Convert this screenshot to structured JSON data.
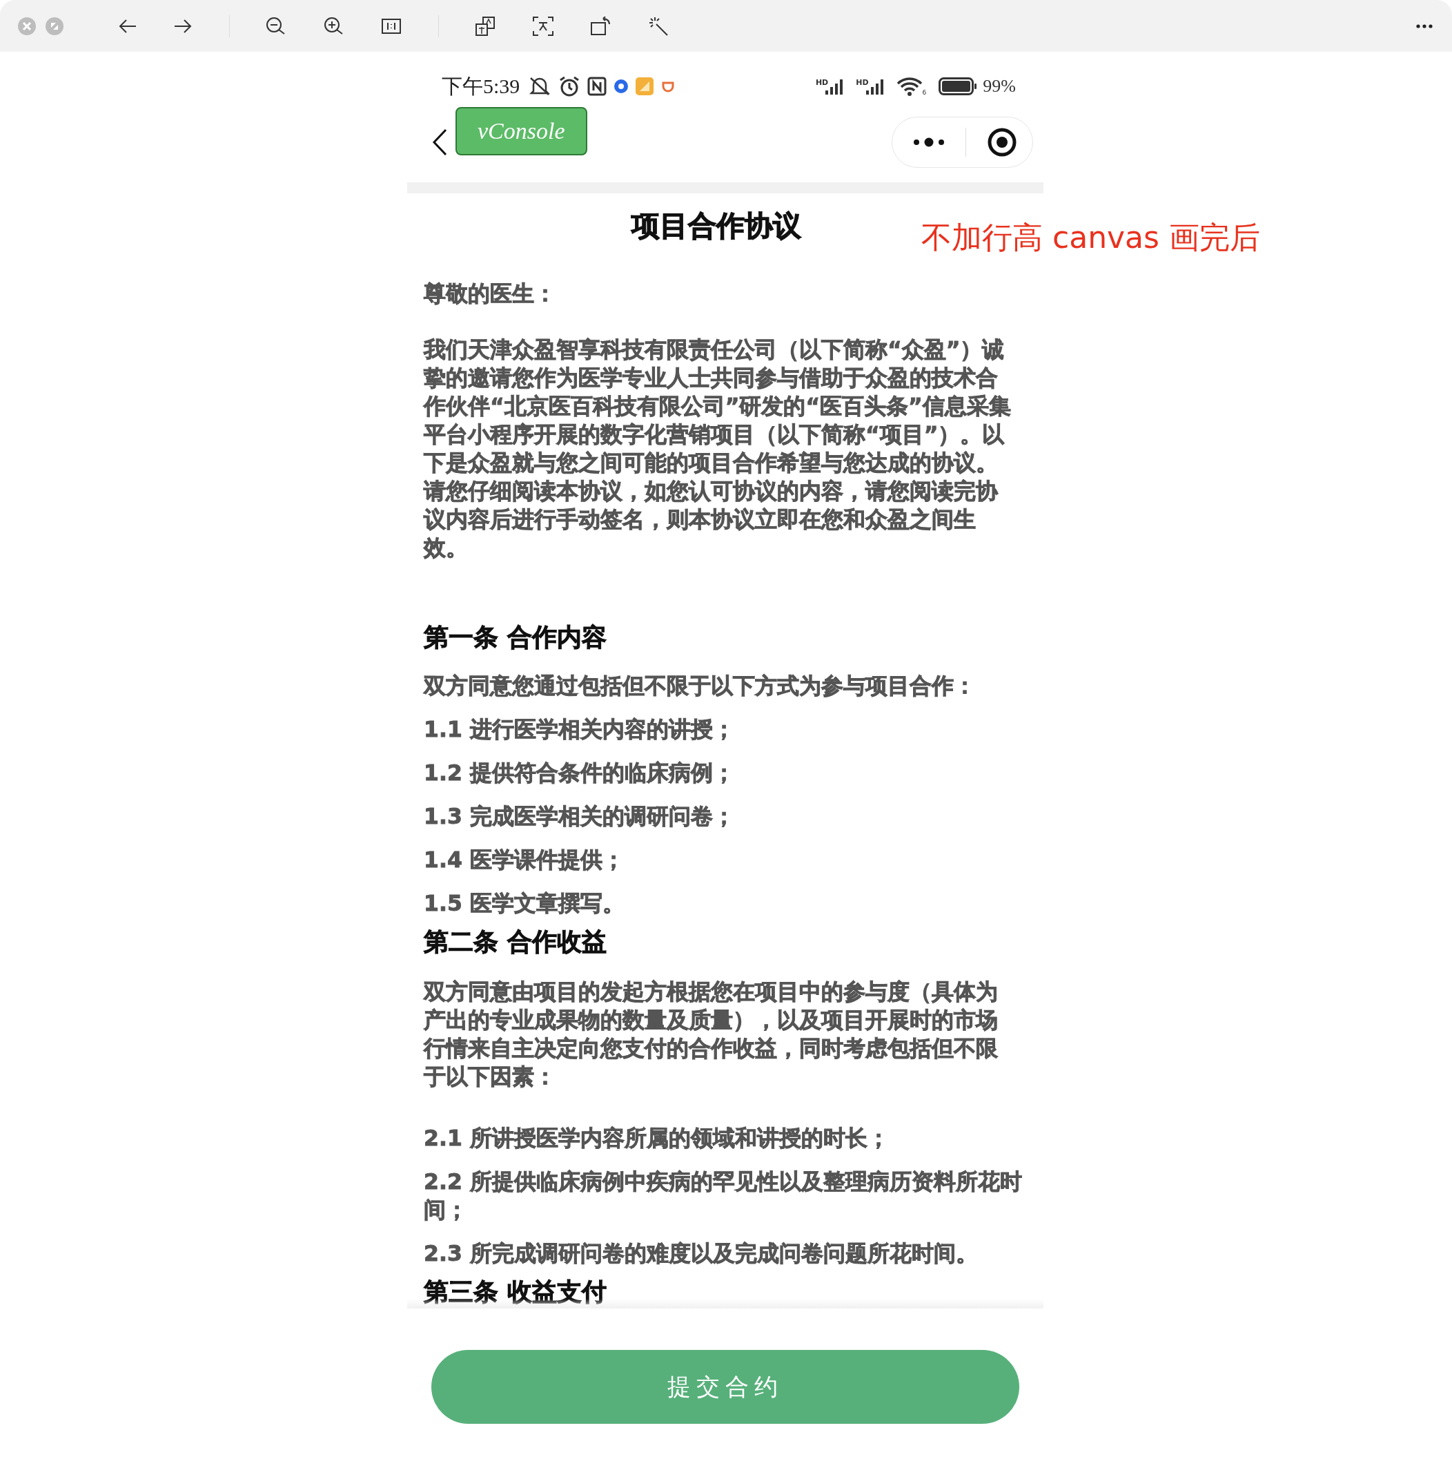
{
  "status_bar": {
    "time": "下午5:39",
    "signal_labels": [
      "HD",
      "HD"
    ],
    "wifi_band": "6",
    "battery": "99%"
  },
  "nav_bar": {
    "vconsole": "vConsole"
  },
  "annotation": "不加行高 canvas 画完后",
  "document": {
    "title": "项目合作协议",
    "blocks": [
      {
        "kind": "greeting",
        "text": "尊敬的医生："
      },
      {
        "kind": "paragraph",
        "text": "我们天津众盈智享科技有限责任公司（以下简称“众盈”）诚挚的邀请您作为医学专业人士共同参与借助于众盈的技术合作伙伴“北京医百科技有限公司”研发的“医百头条”信息采集平台小程序开展的数字化营销项目（以下简称“项目”）。以下是众盈就与您之间可能的项目合作希望与您达成的协议。请您仔细阅读本协议，如您认可协议的内容，请您阅读完协议内容后进行手动签名，则本协议立即在您和众盈之间生效。"
      },
      {
        "kind": "heading",
        "text": "第一条 合作内容"
      },
      {
        "kind": "lead",
        "text": "双方同意您通过包括但不限于以下方式为参与项目合作："
      },
      {
        "kind": "item",
        "text": "1.1 进行医学相关内容的讲授；"
      },
      {
        "kind": "item",
        "text": "1.2 提供符合条件的临床病例；"
      },
      {
        "kind": "item",
        "text": "1.3 完成医学相关的调研问卷；"
      },
      {
        "kind": "item",
        "text": "1.4 医学课件提供；"
      },
      {
        "kind": "item",
        "text": "1.5 医学文章撰写。"
      },
      {
        "kind": "heading",
        "text": "第二条 合作收益"
      },
      {
        "kind": "paragraph",
        "text": "双方同意由项目的发起方根据您在项目中的参与度（具体为产出的专业成果物的数量及质量），以及项目开展时的市场行情来自主决定向您支付的合作收益，同时考虑包括但不限于以下因素："
      },
      {
        "kind": "item",
        "text": "2.1 所讲授医学内容所属的领域和讲授的时长；"
      },
      {
        "kind": "item",
        "text": "2.2 所提供临床病例中疾病的罕见性以及整理病历资料所花时间；"
      },
      {
        "kind": "item",
        "text": "2.3 所完成调研问卷的难度以及完成问卷问题所花时间。"
      },
      {
        "kind": "heading",
        "text": "第三条 收益支付"
      }
    ]
  },
  "submit_button": "提交合约"
}
